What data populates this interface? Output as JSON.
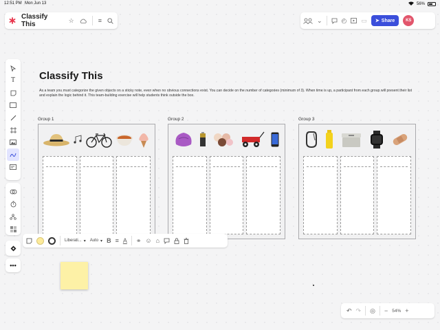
{
  "status_bar": {
    "time": "12:51 PM",
    "date": "Mon Jun 13",
    "battery": "56%"
  },
  "header": {
    "title": "Classify This",
    "share_label": "Share",
    "avatar_initials": "KS"
  },
  "canvas": {
    "title": "Classify This",
    "instructions": "As a team you must categorize the given objects on a sticky note, even when no obvious connections exist. You can decide on the number of categories (minimum of 3). When time is up, a participant from each group will present their list and explain the logic behind it. This team-building exercise will help students think outside the box.",
    "groups": [
      {
        "label": "Group 1",
        "items": [
          "straw-hat",
          "music-notes",
          "bicycle",
          "soup-bowl",
          "ice-cream"
        ]
      },
      {
        "label": "Group 2",
        "items": [
          "bean-bag",
          "battery",
          "ice-cream-scoops",
          "wagon",
          "phone"
        ]
      },
      {
        "label": "Group 3",
        "items": [
          "carabiner",
          "water-bottle",
          "cooler",
          "smartwatch",
          "bandage"
        ]
      }
    ]
  },
  "format_toolbar": {
    "font": "Liberati...",
    "size": "Auto"
  },
  "zoom": {
    "level": "54%"
  },
  "colors": {
    "accent": "#3b4fdb",
    "avatar": "#e2566c",
    "sticky": "#fdf1a6",
    "logo": "#e8334a"
  }
}
